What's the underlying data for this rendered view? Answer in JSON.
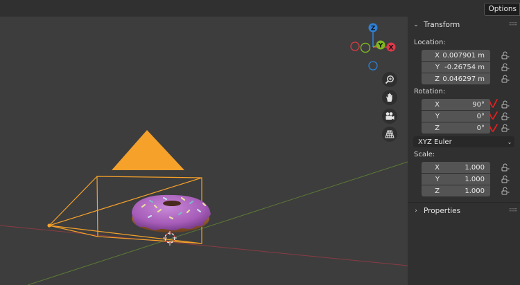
{
  "topbar": {
    "options_label": "Options"
  },
  "gizmo": {
    "z_label": "Z",
    "y_label": "Y",
    "x_label": "X"
  },
  "colors": {
    "panel_bg": "#303030",
    "field_bg": "#545454",
    "camera_orange": "#f5a12a",
    "axis_x": "#db3a4a",
    "axis_y": "#7fb71f",
    "axis_z": "#2f80d6",
    "donut_icing": "#b26bc4",
    "check_red": "#e02020"
  },
  "nav_icons": [
    "zoom-icon",
    "hand-pan-icon",
    "camera-view-icon",
    "grid-perspective-icon"
  ],
  "transform": {
    "title": "Transform",
    "location_label": "Location:",
    "location": [
      {
        "axis": "X",
        "value": "0.007901 m"
      },
      {
        "axis": "Y",
        "value": "-0.26754 m"
      },
      {
        "axis": "Z",
        "value": "0.046297 m"
      }
    ],
    "rotation_label": "Rotation:",
    "rotation": [
      {
        "axis": "X",
        "value": "90°"
      },
      {
        "axis": "Y",
        "value": "0°"
      },
      {
        "axis": "Z",
        "value": "0°"
      }
    ],
    "rotation_mode": "XYZ Euler",
    "scale_label": "Scale:",
    "scale": [
      {
        "axis": "X",
        "value": "1.000"
      },
      {
        "axis": "Y",
        "value": "1.000"
      },
      {
        "axis": "Z",
        "value": "1.000"
      }
    ]
  },
  "properties": {
    "title": "Properties"
  }
}
